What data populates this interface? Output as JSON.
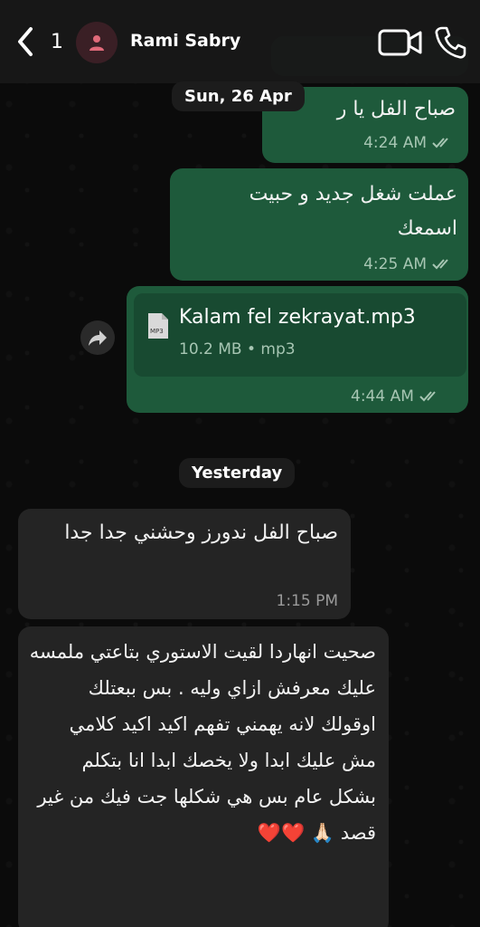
{
  "header": {
    "back_count": "1",
    "contact_name": "Rami Sabry"
  },
  "dates": {
    "top": "Sun, 26 Apr",
    "middle": "Yesterday"
  },
  "messages": [
    {
      "text": "صباح الفل يا ر",
      "time": "4:24 AM"
    },
    {
      "text": "عملت شغل جديد و حبيت اسمعك",
      "time": "4:25 AM"
    },
    {
      "file_name": "Kalam fel zekrayat.mp3",
      "file_info": "10.2 MB • mp3",
      "file_badge": "MP3",
      "time": "4:44 AM"
    },
    {
      "text": "صباح الفل ندورز وحشني جدا جدا",
      "time": "1:15 PM"
    },
    {
      "text": "صحيت انهاردا لقيت الاستوري بتاعتي ملمسه عليك معرفش ازاي وليه . بس ببعتلك اوقولك لانه يهمني تفهم اكيد اكيد كلامي مش عليك ابدا ولا يخصك ابدا انا بتكلم بشكل عام بس هي شكلها جت فيك من غير قصد 🙏🏻 ❤️❤️"
    }
  ],
  "colors": {
    "outgoing": "#1e5a3b",
    "incoming": "#242424",
    "background": "#0b0b0b"
  },
  "icons": [
    "chevron-left-icon",
    "person-icon",
    "video-call-icon",
    "phone-icon",
    "double-check-icon",
    "mp3-file-icon",
    "forward-icon"
  ]
}
